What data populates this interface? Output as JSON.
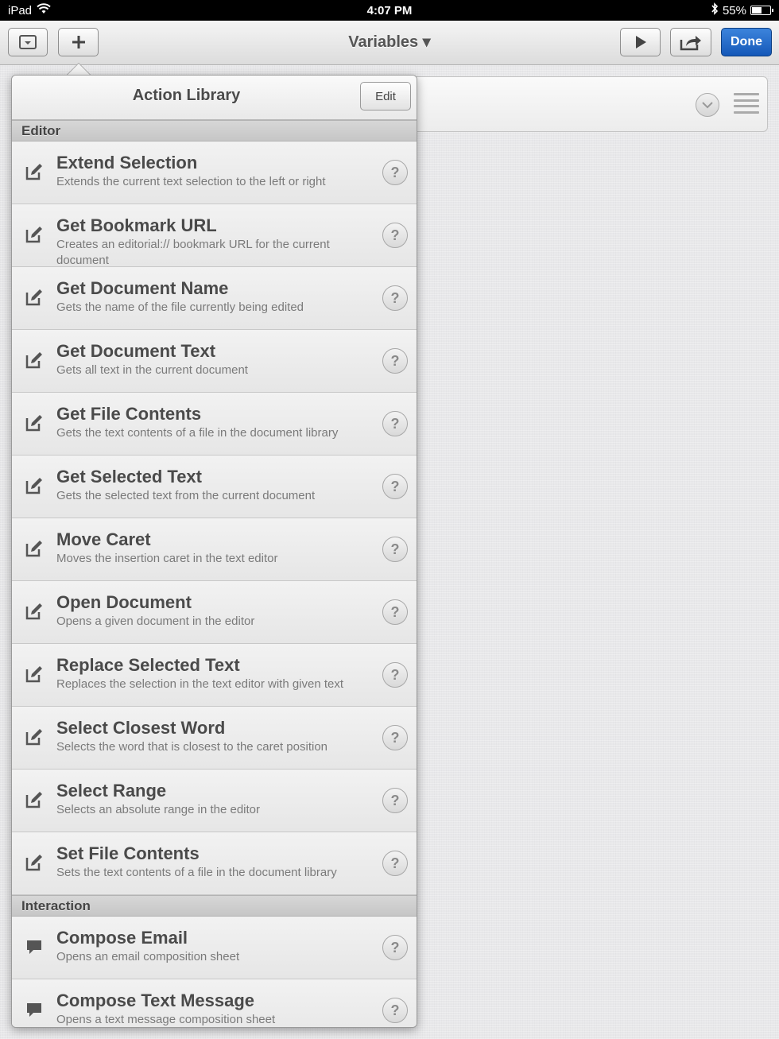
{
  "status_bar": {
    "device": "iPad",
    "time": "4:07 PM",
    "battery": "55%",
    "battery_level": 0.55
  },
  "toolbar": {
    "title": "Variables ▾",
    "done_label": "Done"
  },
  "popover": {
    "title": "Action Library",
    "edit_label": "Edit",
    "sections": [
      {
        "name": "Editor",
        "icon": "edit-pencil-icon",
        "items": [
          {
            "title": "Extend Selection",
            "desc": "Extends the current text selection to the left or right"
          },
          {
            "title": "Get Bookmark URL",
            "desc": "Creates an editorial:// bookmark URL for the current document"
          },
          {
            "title": "Get Document Name",
            "desc": "Gets the name of the file currently being edited"
          },
          {
            "title": "Get Document Text",
            "desc": "Gets all text in the current document"
          },
          {
            "title": "Get File Contents",
            "desc": "Gets the text contents of a file in the document library"
          },
          {
            "title": "Get Selected Text",
            "desc": "Gets the selected text from the current document"
          },
          {
            "title": "Move Caret",
            "desc": "Moves the insertion caret in the text editor"
          },
          {
            "title": "Open Document",
            "desc": "Opens a given document in the editor"
          },
          {
            "title": "Replace Selected Text",
            "desc": "Replaces the selection in the text editor with given text"
          },
          {
            "title": "Select Closest Word",
            "desc": "Selects the word that is closest to the caret position"
          },
          {
            "title": "Select Range",
            "desc": "Selects an absolute range in the editor"
          },
          {
            "title": "Set File Contents",
            "desc": "Sets the text contents of a file in the document library"
          }
        ]
      },
      {
        "name": "Interaction",
        "icon": "speech-bubble-icon",
        "items": [
          {
            "title": "Compose Email",
            "desc": "Opens an email composition sheet"
          },
          {
            "title": "Compose Text Message",
            "desc": "Opens a text message composition sheet"
          }
        ]
      }
    ]
  },
  "help_symbol": "?"
}
